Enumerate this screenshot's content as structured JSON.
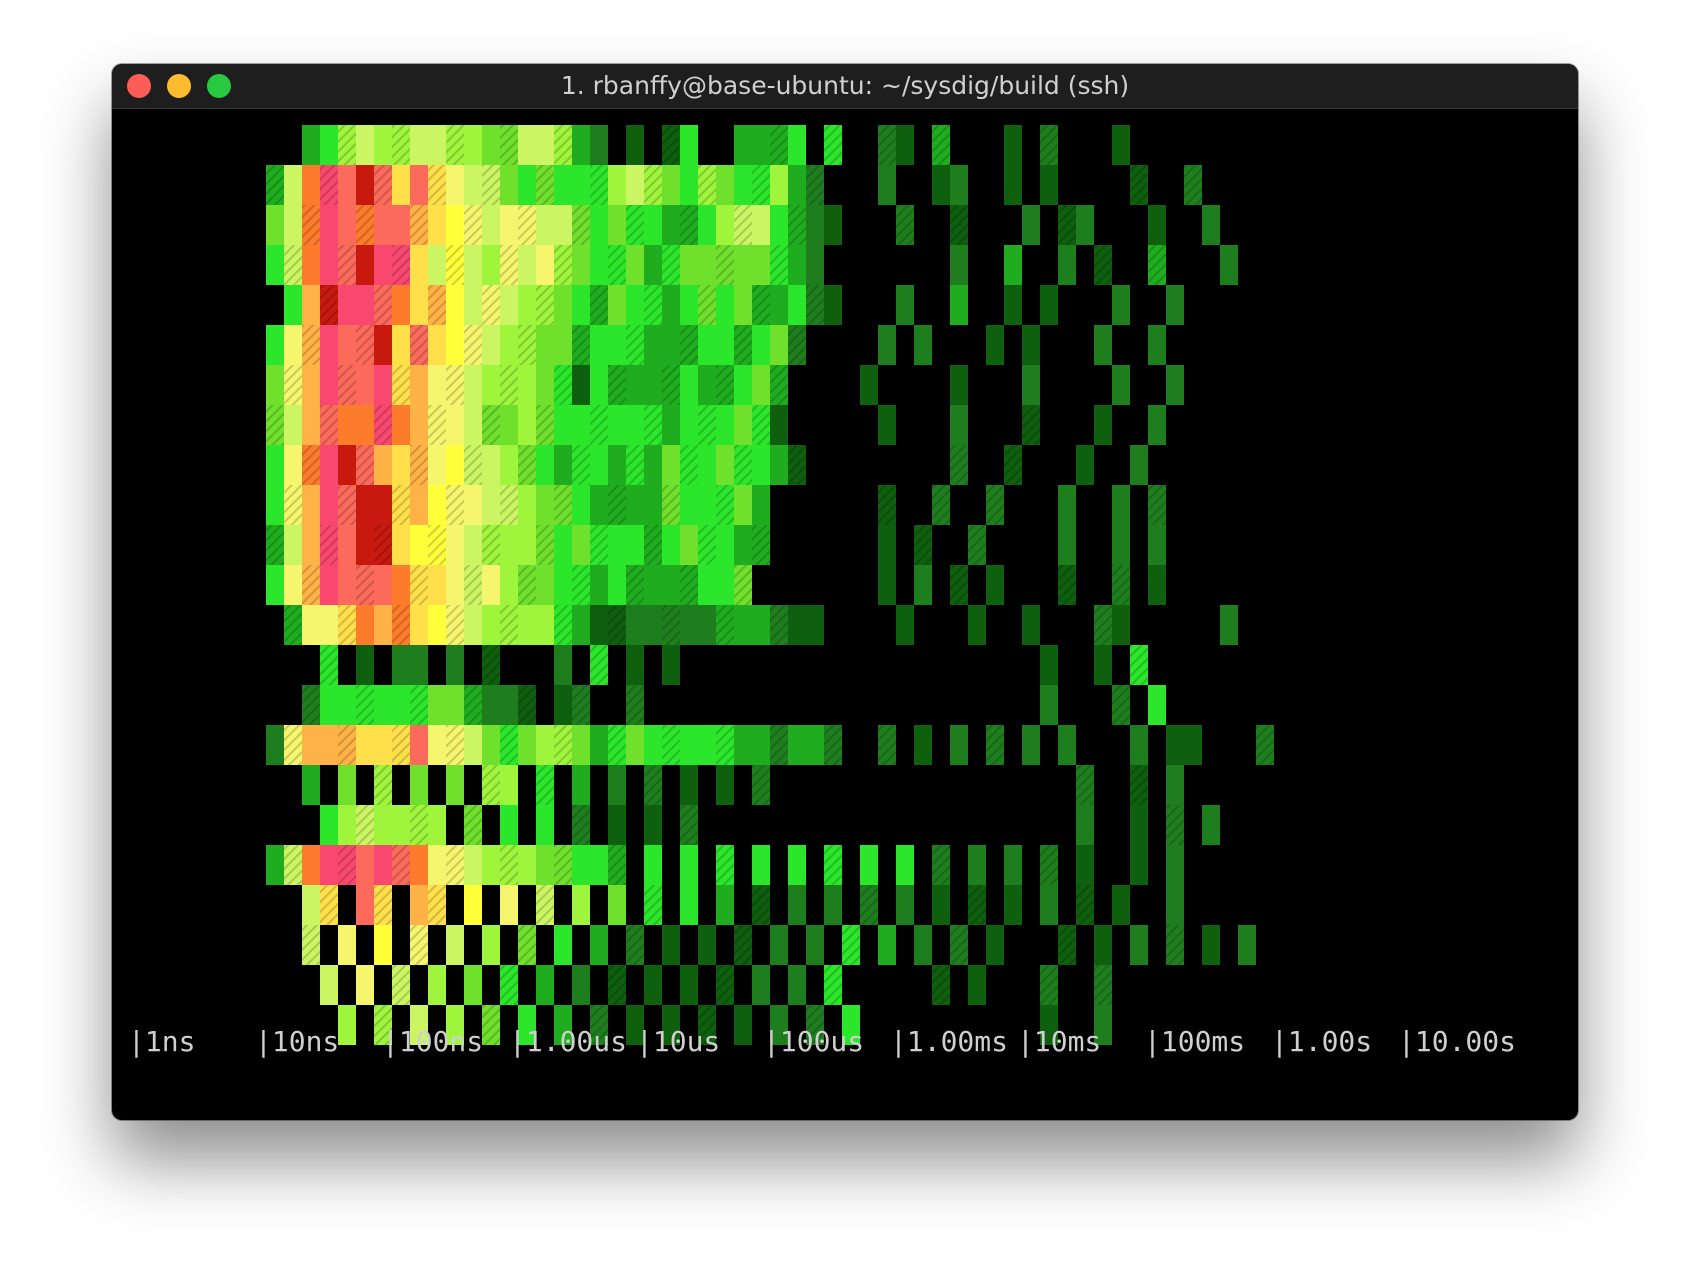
{
  "window": {
    "title": "1. rbanffy@base-ubuntu: ~/sysdig/build (ssh)"
  },
  "colors": {
    "background": "#000000",
    "axis_text": "#cfcfcf",
    "palette": [
      "#0e5f0e",
      "#1e7e1e",
      "#1fad1f",
      "#2be62b",
      "#6fe02c",
      "#9ff53c",
      "#ccf563",
      "#f5f56e",
      "#ffff3a",
      "#ffe04a",
      "#ffb347",
      "#fc7c2c",
      "#fb6a5b",
      "#f9486f",
      "#c8190f"
    ]
  },
  "chart_data": {
    "type": "heatmap",
    "title": "",
    "xlabel": "",
    "ylabel": "",
    "scale": "log",
    "x_ticks": [
      "1ns",
      "10ns",
      "100ns",
      "1.00us",
      "10us",
      "100us",
      "1.00ms",
      "10ms",
      "100ms",
      "1.00s",
      "10.00s"
    ],
    "cols": 66,
    "rows": 23,
    "grid": [
      "          23565566554466521 0 03  2223 3  10 2   0 1   0          ",
      "        26BDCEC9C9766434333565435433521   1  01  0 0    0  1      ",
      "        46BDCBCCA98767766434332235663210   1  0   1 01   0  1      ",
      "        36BDCEDD96865767543342344444321       1  2  1 0  2   1      ",
      "         3AEDDCB9A8676554324332343422310   1  2  0 0   1  1      ",
      "        37ADCCE9C987655442333222332341    1 1   0 0   1  1      ",
      "        47ADCCD9A77655543032222322342    0    0   1    1  1      ",
      "        46ACBBDBA77644543333332333430     0   1   0   0  1      ",
      "        37BDECA9A786654323323243343320        1  0   0  1      ",
      "        37ADCEE9A8776654432222433342      0  1  1   1  1 1      ",
      "        26ADCEE988765554343332343322      0 0  1    1  1 1      ",
      "        37ADCCCB9976754433232222334       0 1 0 0   0  1 0      ",
      "         2779BAB98765555320011111222100    0   0  0   10     1  ",
      "           3 0 11 1 0   1 3 0 0                    0  0 3       ",
      "          1333333442110 01  1                      1   1 3      ",
      "        17AAA999C77643455423433333221221  1 0 1 1 1 1   1 00   1",
      "          2 4 5 4 4 55 3 2 1 1 0 0 1                 1  0 1      ",
      "           3565555 4 3 3 1 0 0 1                     1  0 1 1   ",
      "        26BDDCDCB77655544332 3 3 3 3 3 3 3 3 1 1 1 1 0  0 1     ",
      "          69 C9 A9 8 7 6 5 4 3 3 2 0 1 1 1 1 0 0 0 1 0 0  1     ",
      "          6 7 8 7 6 5 4 3 2 1 0 0 0 1 1 3 2 1 1 0   0 0 1 1 0 1 ",
      "           6 7 6 5 4 3 2 1 0 0 0 0 1 1 3     0 0   1  1          ",
      "            5 5 6 5 4 3 2 1 0 0 0 0 1 1 3          0  1          "
    ]
  }
}
